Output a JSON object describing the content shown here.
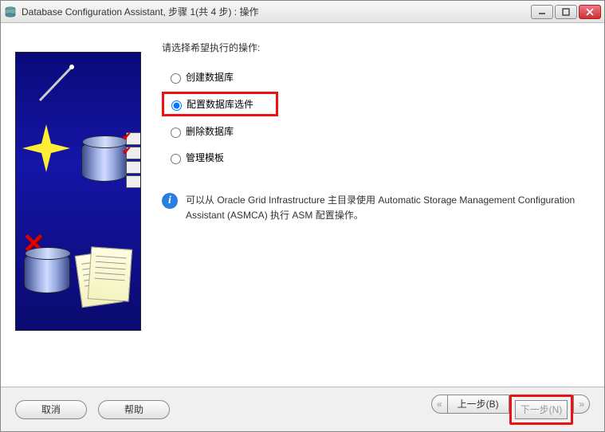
{
  "window": {
    "title": "Database Configuration Assistant, 步骤 1(共 4 步) : 操作"
  },
  "prompt": "请选择希望执行的操作:",
  "options": {
    "create": "创建数据库",
    "configure": "配置数据库选件",
    "delete": "删除数据库",
    "template": "管理模板"
  },
  "selected_option": "configure",
  "info_text": "可以从 Oracle Grid Infrastructure 主目录使用 Automatic Storage Management Configuration Assistant (ASMCA) 执行 ASM 配置操作。",
  "footer": {
    "cancel": "取消",
    "help": "帮助",
    "back": "上一步(B)",
    "next": "下一步(N)"
  }
}
